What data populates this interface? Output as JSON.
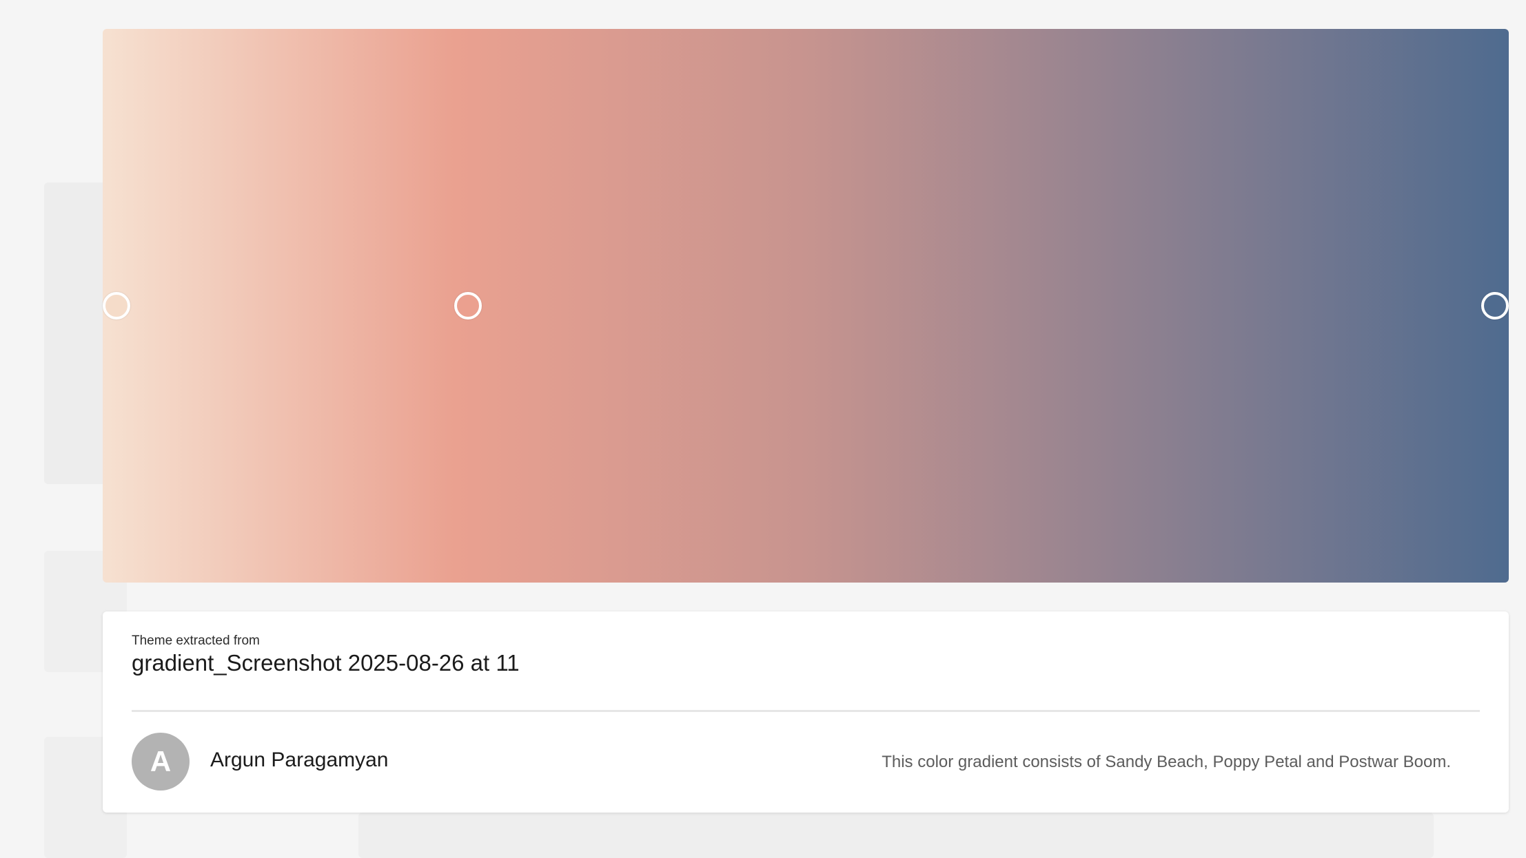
{
  "gradient": {
    "colors": [
      "#f6e1d1",
      "#eaa190",
      "#c7948f",
      "#8c8090",
      "#4f6b8f"
    ],
    "stops": [
      {
        "name": "Sandy Beach",
        "color": "#f5dcc9",
        "position": 0.01
      },
      {
        "name": "Poppy Petal",
        "color": "#eba08f",
        "position": 0.26
      },
      {
        "name": "Postwar Boom",
        "color": "#4f6b8f",
        "position": 0.99
      }
    ]
  },
  "card": {
    "extracted_label": "Theme extracted from",
    "title": "gradient_Screenshot 2025-08-26 at 11",
    "author": {
      "initial": "A",
      "name": "Argun Paragamyan"
    },
    "description": "This color gradient consists of Sandy Beach, Poppy Petal and Postwar Boom."
  }
}
